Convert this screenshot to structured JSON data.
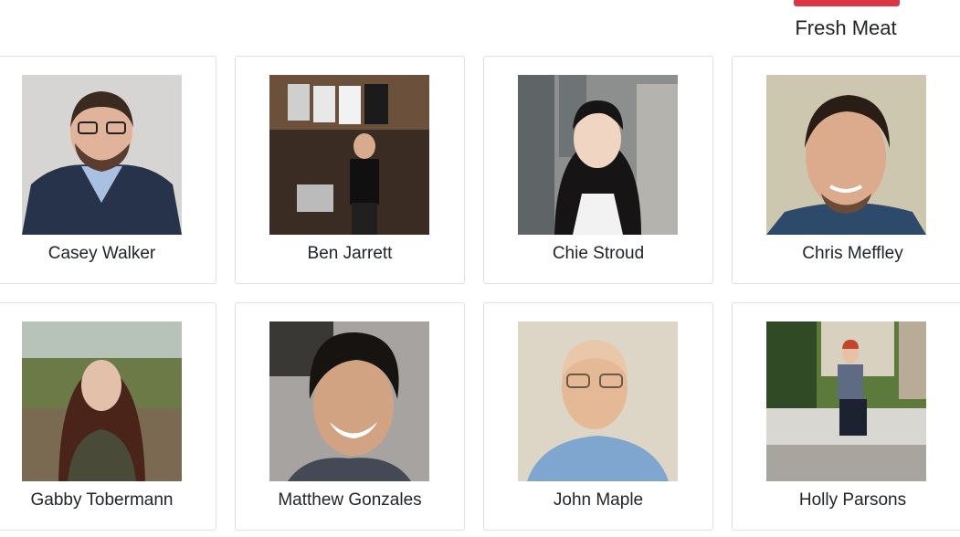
{
  "section": {
    "heading": "Fresh Meat",
    "accent_color": "#dc3545"
  },
  "members": [
    {
      "name": "Casey Walker"
    },
    {
      "name": "Ben Jarrett"
    },
    {
      "name": "Chie Stroud"
    },
    {
      "name": "Chris Meffley"
    },
    {
      "name": "Gabby Tobermann"
    },
    {
      "name": "Matthew Gonzales"
    },
    {
      "name": "John Maple"
    },
    {
      "name": "Holly Parsons"
    }
  ]
}
